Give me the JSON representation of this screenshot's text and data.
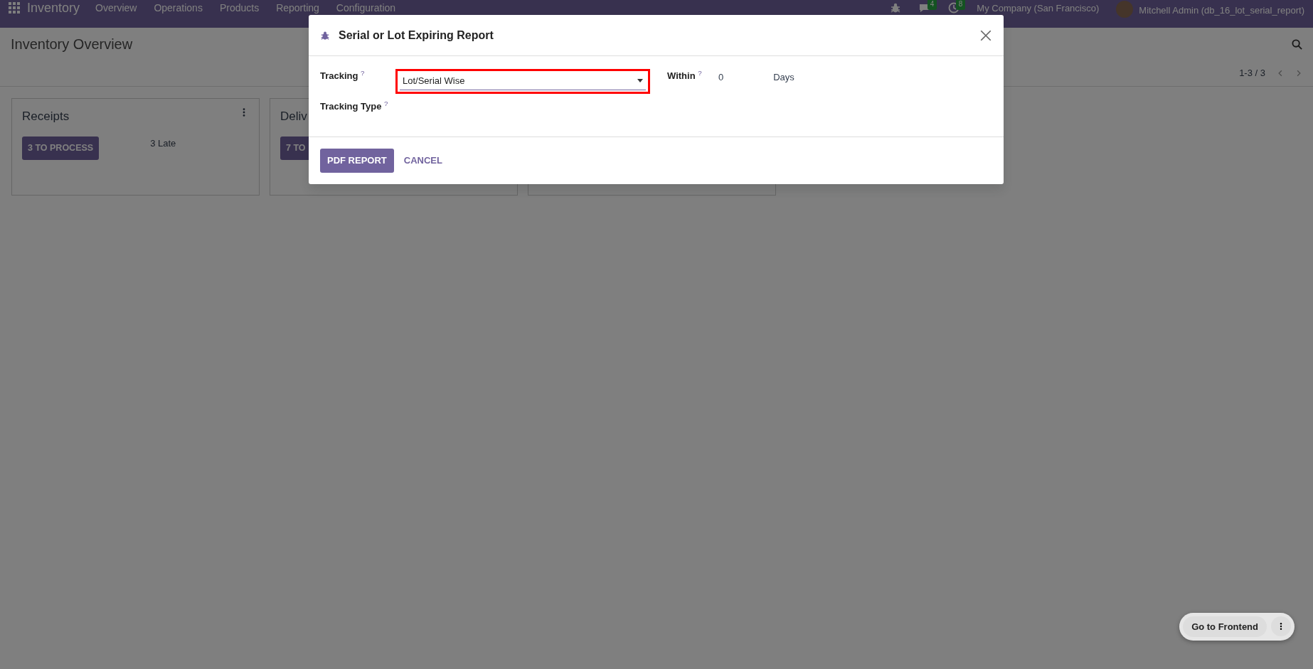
{
  "navbar": {
    "app_name": "Inventory",
    "menu": [
      {
        "label": "Overview"
      },
      {
        "label": "Operations"
      },
      {
        "label": "Products"
      },
      {
        "label": "Reporting"
      },
      {
        "label": "Configuration"
      }
    ],
    "systray": [
      {
        "kind": "debug"
      },
      {
        "kind": "chat",
        "badge": "4"
      },
      {
        "kind": "activity",
        "badge": "8"
      }
    ],
    "company": "My Company (San Francisco)",
    "user": "Mitchell Admin (db_16_lot_serial_report)"
  },
  "control_panel": {
    "title": "Inventory Overview",
    "pager": "1-3 / 3"
  },
  "cards": [
    {
      "kind": "operation",
      "title": "Receipts",
      "button": "3 TO PROCESS",
      "late": "3 Late",
      "menu": true
    },
    {
      "kind": "operation",
      "title": "Deliv",
      "button": "7 TO"
    },
    {
      "kind": "operation"
    }
  ],
  "dialog": {
    "title": "Serial or Lot Expiring Report",
    "fields": [
      {
        "kind": "select",
        "label": "Tracking",
        "help": "?",
        "value": "Lot/Serial Wise",
        "highlighted": true
      },
      {
        "kind": "number",
        "label": "Within",
        "help": "?",
        "value": "0",
        "unit": "Days"
      },
      {
        "kind": "empty",
        "label": "Tracking Type",
        "help": "?"
      }
    ],
    "buttons": [
      {
        "label": "PDF REPORT",
        "primary": true
      },
      {
        "label": "CANCEL",
        "primary": false
      }
    ]
  },
  "frontend_button": {
    "label": "Go to Frontend"
  }
}
